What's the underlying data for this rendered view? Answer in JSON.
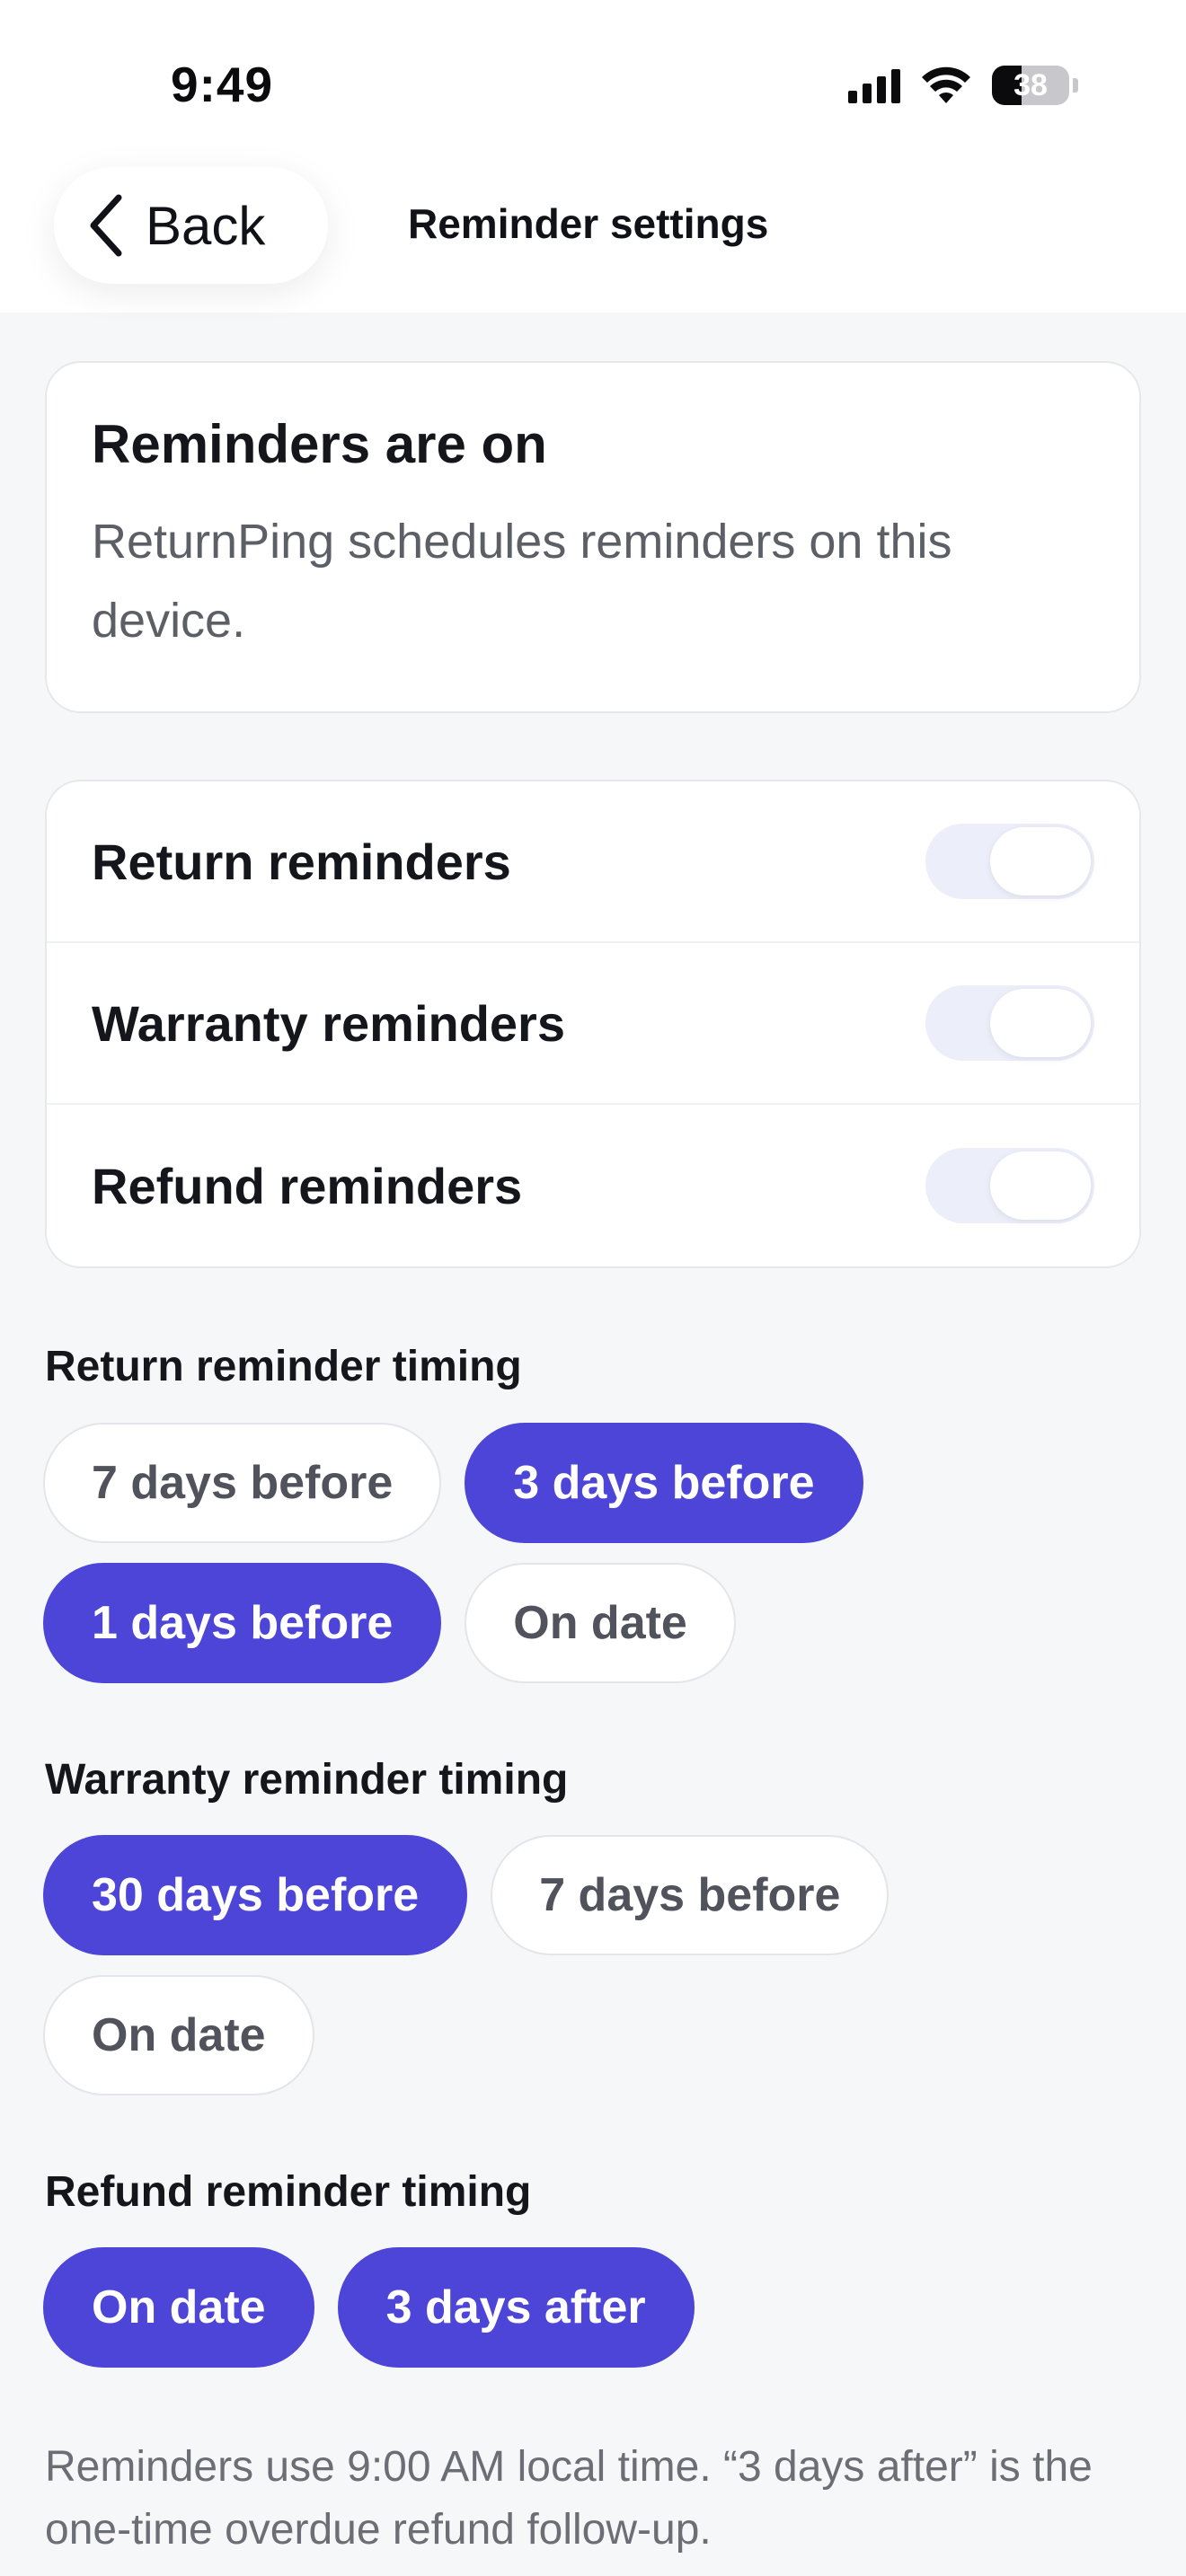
{
  "status_bar": {
    "time": "9:49",
    "battery": "38"
  },
  "header": {
    "back_label": "Back",
    "title": "Reminder settings"
  },
  "status_card": {
    "title": "Reminders are on",
    "description": "ReturnPing schedules reminders on this device."
  },
  "toggles": [
    {
      "label": "Return reminders",
      "on": true
    },
    {
      "label": "Warranty reminders",
      "on": true
    },
    {
      "label": "Refund reminders",
      "on": true
    }
  ],
  "sections": {
    "return": {
      "title": "Return reminder timing",
      "chips": [
        {
          "label": "7 days before",
          "selected": false
        },
        {
          "label": "3 days before",
          "selected": true
        },
        {
          "label": "1 days before",
          "selected": true
        },
        {
          "label": "On date",
          "selected": false
        }
      ]
    },
    "warranty": {
      "title": "Warranty reminder timing",
      "chips": [
        {
          "label": "30 days before",
          "selected": true
        },
        {
          "label": "7 days before",
          "selected": false
        },
        {
          "label": "On date",
          "selected": false
        }
      ]
    },
    "refund": {
      "title": "Refund reminder timing",
      "chips": [
        {
          "label": "On date",
          "selected": true
        },
        {
          "label": "3 days after",
          "selected": true
        }
      ]
    }
  },
  "footnote": "Reminders use 9:00 AM local time. “3 days after” is the one-time overdue refund follow-up.",
  "colors": {
    "accent": "#4c45d8",
    "background": "#f6f7f9",
    "card": "#ffffff"
  }
}
